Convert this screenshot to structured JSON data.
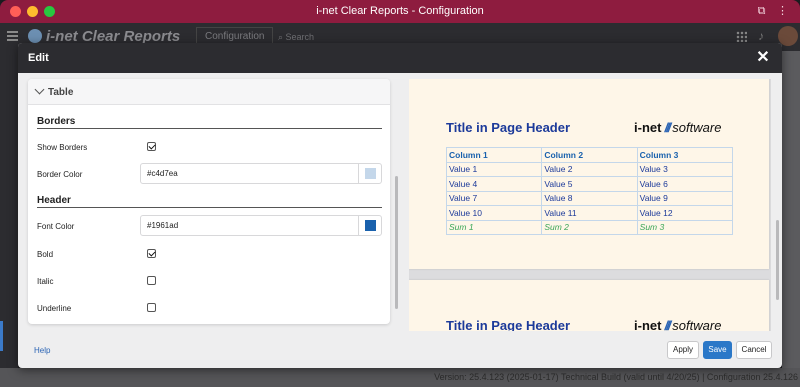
{
  "window": {
    "title": "i-net Clear Reports - Configuration"
  },
  "app": {
    "brand": "i-net Clear Reports",
    "section": "Configuration",
    "search_placeholder": "Search",
    "sidebar_settings": "Settings",
    "version": "Version: 25.4.123 (2025-01-17) Technical Build (valid until 4/20/25) | Configuration 25.4.126"
  },
  "dialog": {
    "title": "Edit",
    "panel_title": "Table",
    "borders": {
      "title": "Borders",
      "show_borders_label": "Show Borders",
      "show_borders": true,
      "border_color_label": "Border Color",
      "border_color": "#c4d7ea"
    },
    "header": {
      "title": "Header",
      "font_color_label": "Font Color",
      "font_color": "#1961ad",
      "bold_label": "Bold",
      "bold": true,
      "italic_label": "Italic",
      "italic": false,
      "underline_label": "Underline",
      "underline": false
    },
    "help": "Help",
    "apply": "Apply",
    "save": "Save",
    "cancel": "Cancel"
  },
  "preview": {
    "page_title": "Title in Page Header",
    "vendor": {
      "inet": "i-net",
      "slashes": "///",
      "software": "software"
    },
    "table": {
      "columns": [
        "Column 1",
        "Column 2",
        "Column 3"
      ],
      "rows": [
        [
          "Value 1",
          "Value 2",
          "Value 3"
        ],
        [
          "Value 4",
          "Value 5",
          "Value 6"
        ],
        [
          "Value 7",
          "Value 8",
          "Value 9"
        ],
        [
          "Value 10",
          "Value 11",
          "Value 12"
        ]
      ],
      "sums": [
        "Sum 1",
        "Sum 2",
        "Sum 3"
      ]
    }
  }
}
